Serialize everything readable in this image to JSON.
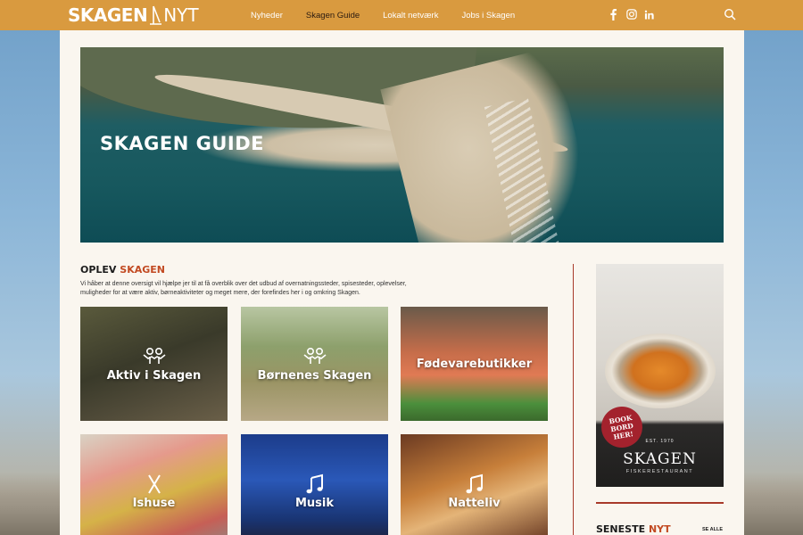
{
  "header": {
    "logo_left": "SKAGEN",
    "logo_right": "NYT",
    "nav": [
      "Nyheder",
      "Skagen Guide",
      "Lokalt netværk",
      "Jobs i Skagen"
    ],
    "active_nav": "Skagen Guide",
    "bar_color": "#d99a3f",
    "social_icons": [
      "facebook-icon",
      "instagram-icon",
      "linkedin-icon"
    ],
    "search_icon": "search-icon"
  },
  "hero": {
    "title": "SKAGEN GUIDE"
  },
  "intro": {
    "heading_main": "OPLEV ",
    "heading_accent": "SKAGEN",
    "text": "Vi håber at denne oversigt vil hjælpe jer til at få overblik over det udbud af overnatningssteder, spisesteder, oplevelser, muligheder for at være aktiv, børneaktiviteter og meget mere, der forefindes her i og omkring Skagen."
  },
  "tiles": [
    {
      "label": "Aktiv i Skagen",
      "icon": "people-icon"
    },
    {
      "label": "Børnenes Skagen",
      "icon": "people-icon"
    },
    {
      "label": "Fødevarebutikker",
      "icon": ""
    },
    {
      "label": "Ishuse",
      "icon": "cutlery-icon"
    },
    {
      "label": "Musik",
      "icon": "music-note-icon"
    },
    {
      "label": "Natteliv",
      "icon": "music-note-icon"
    }
  ],
  "ad": {
    "badge": "BOOK BORD HER!",
    "est": "EST. 1970",
    "brand": "SKAGEN",
    "subtitle": "FISKERESTAURANT"
  },
  "news": {
    "heading_main": "SENESTE ",
    "heading_accent": "NYT",
    "see_all": "SE ALLE"
  },
  "colors": {
    "accent": "#c24a22",
    "divider": "#a83a2a",
    "page_bg": "#faf6ef"
  }
}
